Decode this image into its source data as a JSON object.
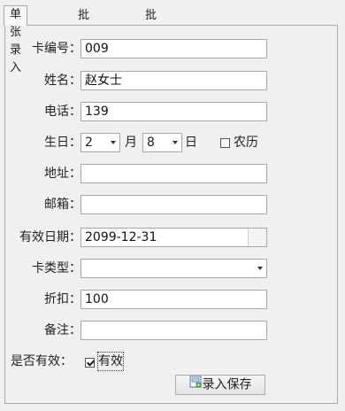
{
  "tabs": [
    "单张录入",
    "批量录入",
    "批量导入"
  ],
  "form": {
    "card_no": {
      "label": "卡编号：",
      "value": "009"
    },
    "name": {
      "label": "姓名：",
      "value": "赵女士"
    },
    "phone": {
      "label": "电话：",
      "value": "139"
    },
    "birthday": {
      "label": "生日：",
      "month_value": "2",
      "month_unit": "月",
      "day_value": "8",
      "day_unit": "日",
      "lunar_label": "农历",
      "lunar_checked": false
    },
    "address": {
      "label": "地址：",
      "value": ""
    },
    "email": {
      "label": "邮箱：",
      "value": ""
    },
    "expiry": {
      "label": "有效日期：",
      "value": "2099-12-31"
    },
    "card_type": {
      "label": "卡类型：",
      "value": ""
    },
    "discount": {
      "label": "折扣：",
      "value": "100"
    },
    "remark": {
      "label": "备注：",
      "value": ""
    },
    "valid": {
      "label": "是否有效：",
      "checkbox_label": "有效",
      "checked": true
    }
  },
  "save_button": {
    "label": "录入保存",
    "icon": "save-entry-icon"
  }
}
